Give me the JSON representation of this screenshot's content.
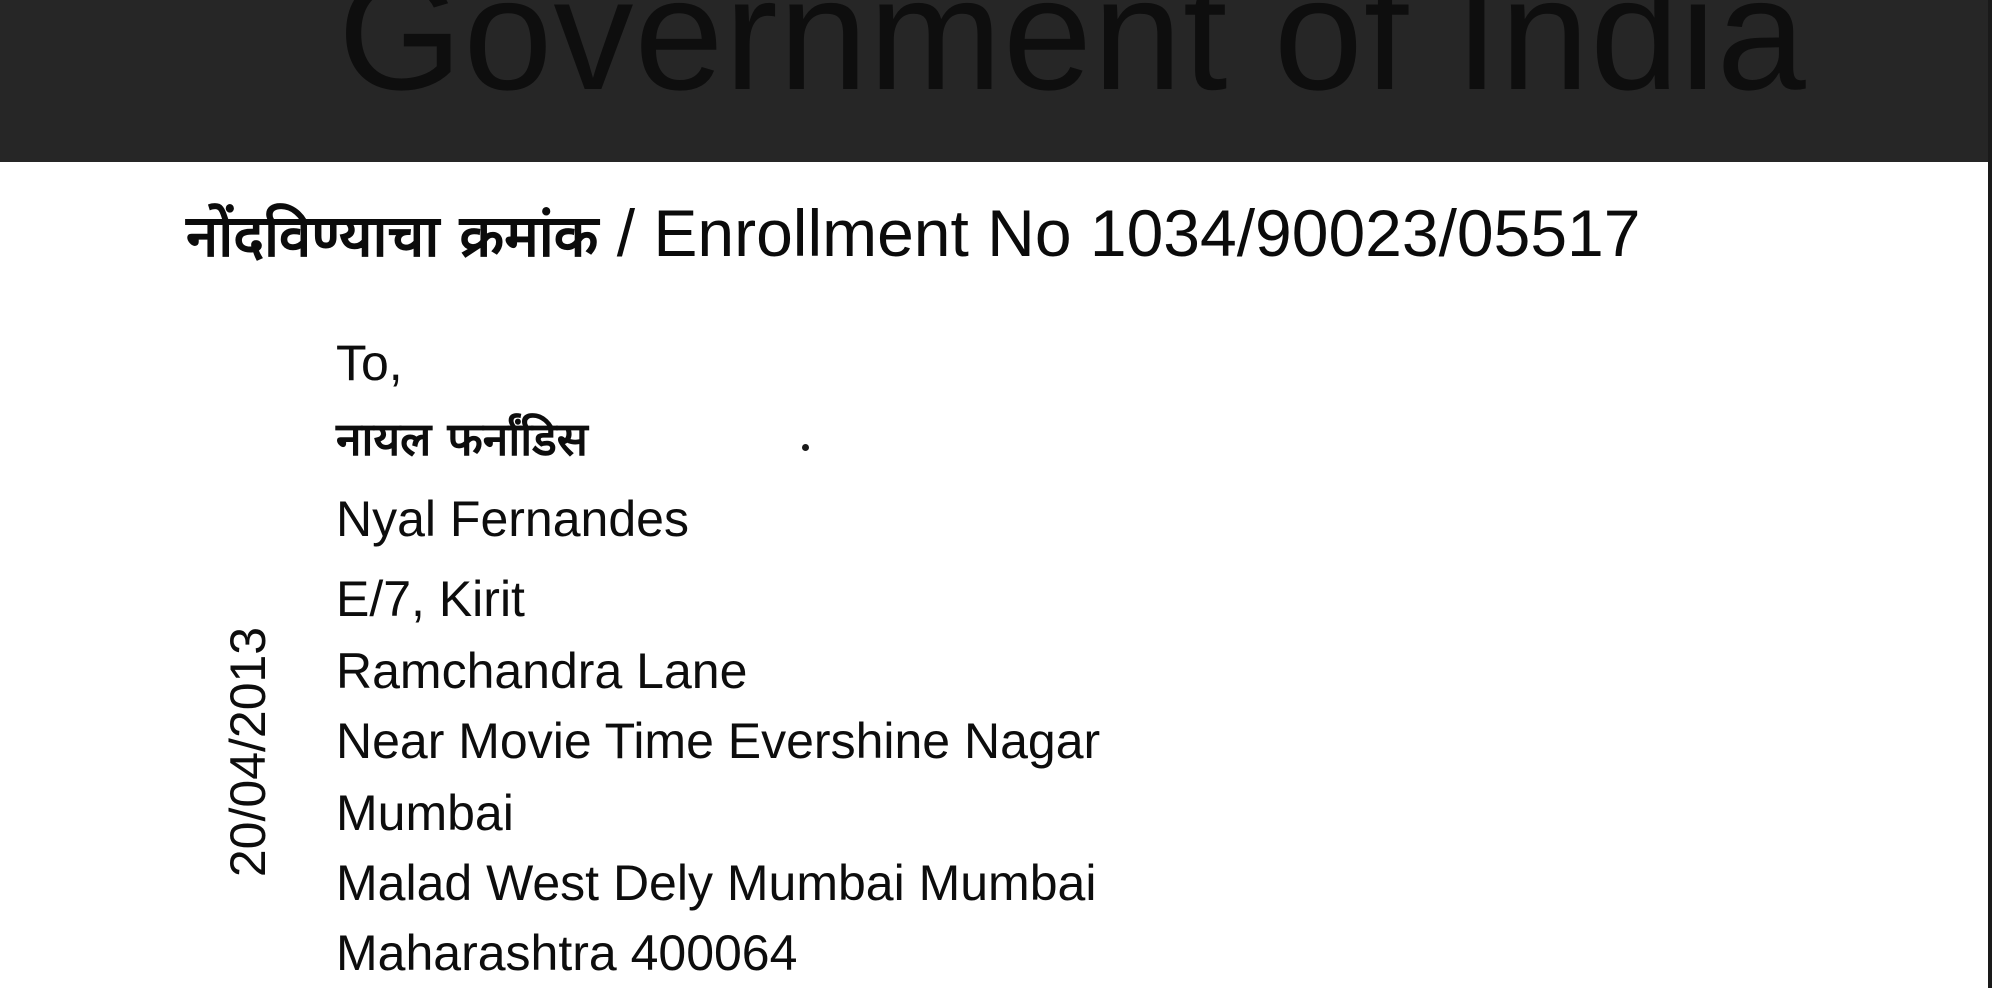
{
  "header": {
    "title": "Government of India"
  },
  "enrollment": {
    "label_devanagari": "नोंदविण्याचा क्रमांक",
    "separator": "/",
    "label_english": "Enrollment No",
    "number": "1034/90023/05517"
  },
  "date_vertical": "20/04/2013",
  "address": {
    "salutation": "To,",
    "name_devanagari": "नायल फर्नांडिस",
    "name": "Nyal Fernandes",
    "lines": [
      "E/7, Kirit",
      "Ramchandra Lane",
      "Near Movie Time Evershine Nagar",
      "Mumbai",
      "Malad West Dely Mumbai Mumbai",
      "Maharashtra 400064"
    ]
  }
}
